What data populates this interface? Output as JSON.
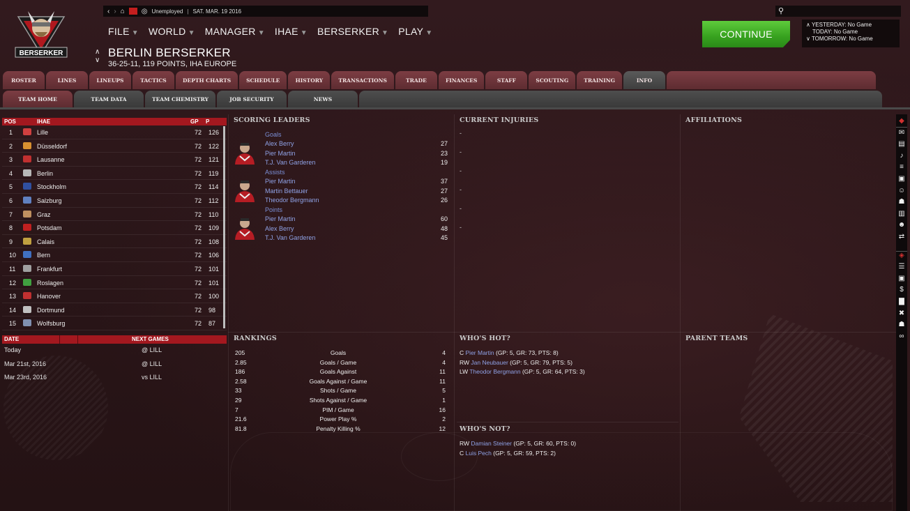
{
  "topbar": {
    "status": "Unemployed",
    "date": "SAT. MAR. 19 2016"
  },
  "logo_text": "BERSERKER",
  "menus": [
    {
      "label": "FILE"
    },
    {
      "label": "WORLD"
    },
    {
      "label": "MANAGER"
    },
    {
      "label": "IHAE"
    },
    {
      "label": "BERSERKER"
    },
    {
      "label": "PLAY"
    }
  ],
  "team": {
    "name": "BERLIN BERSERKER",
    "record": "36-25-11, 119 POINTS, IHA EUROPE"
  },
  "continue_label": "CONTINUE",
  "games": {
    "yesterday": "YESTERDAY: No Game",
    "today": "TODAY: No Game",
    "tomorrow": "TOMORROW: No Game"
  },
  "tabs_main": [
    "ROSTER",
    "LINES",
    "LINEUPS",
    "TACTICS",
    "DEPTH CHARTS",
    "SCHEDULE",
    "HISTORY",
    "TRANSACTIONS",
    "TRADE",
    "FINANCES",
    "STAFF",
    "SCOUTING",
    "TRAINING",
    "INFO"
  ],
  "tabs_main_active": "INFO",
  "tabs_sub": [
    "TEAM HOME",
    "TEAM DATA",
    "TEAM CHEMISTRY",
    "JOB SECURITY",
    "NEWS"
  ],
  "tabs_sub_active": "TEAM HOME",
  "standings": {
    "headers": {
      "pos": "POS",
      "league": "IHAE",
      "gp": "GP",
      "p": "P"
    },
    "rows": [
      {
        "pos": "1",
        "team": "Lille",
        "gp": "72",
        "p": "126",
        "color": "#d04040"
      },
      {
        "pos": "2",
        "team": "Düsseldorf",
        "gp": "72",
        "p": "122",
        "color": "#d89030"
      },
      {
        "pos": "3",
        "team": "Lausanne",
        "gp": "72",
        "p": "121",
        "color": "#c03030"
      },
      {
        "pos": "4",
        "team": "Berlin",
        "gp": "72",
        "p": "119",
        "color": "#b8b8b8"
      },
      {
        "pos": "5",
        "team": "Stockholm",
        "gp": "72",
        "p": "114",
        "color": "#3050a0"
      },
      {
        "pos": "6",
        "team": "Salzburg",
        "gp": "72",
        "p": "112",
        "color": "#6080c0"
      },
      {
        "pos": "7",
        "team": "Graz",
        "gp": "72",
        "p": "110",
        "color": "#c09060"
      },
      {
        "pos": "8",
        "team": "Potsdam",
        "gp": "72",
        "p": "109",
        "color": "#c02020"
      },
      {
        "pos": "9",
        "team": "Calais",
        "gp": "72",
        "p": "108",
        "color": "#c0a040"
      },
      {
        "pos": "10",
        "team": "Bern",
        "gp": "72",
        "p": "106",
        "color": "#4070c0"
      },
      {
        "pos": "11",
        "team": "Frankfurt",
        "gp": "72",
        "p": "101",
        "color": "#a0a0a0"
      },
      {
        "pos": "12",
        "team": "Roslagen",
        "gp": "72",
        "p": "101",
        "color": "#40a040"
      },
      {
        "pos": "13",
        "team": "Hanover",
        "gp": "72",
        "p": "100",
        "color": "#c03030"
      },
      {
        "pos": "14",
        "team": "Dortmund",
        "gp": "72",
        "p": "98",
        "color": "#c0c0c0"
      },
      {
        "pos": "15",
        "team": "Wolfsburg",
        "gp": "72",
        "p": "87",
        "color": "#8090b0"
      }
    ]
  },
  "schedule": {
    "headers": {
      "date": "DATE",
      "next": "NEXT GAMES"
    },
    "rows": [
      {
        "date": "Today",
        "game": "@ LILL"
      },
      {
        "date": "Mar 21st, 2016",
        "game": "@ LILL"
      },
      {
        "date": "Mar 23rd, 2016",
        "game": "vs LILL"
      }
    ]
  },
  "panels": {
    "scoring_leaders": "SCORING LEADERS",
    "current_injuries": "CURRENT INJURIES",
    "affiliations": "AFFILIATIONS",
    "rankings": "RANKINGS",
    "whos_hot": "WHO'S HOT?",
    "whos_not": "WHO'S NOT?",
    "parent_teams": "PARENT TEAMS"
  },
  "leaders": [
    {
      "category": "Goals",
      "players": [
        {
          "name": "Alex Berry",
          "value": "27"
        },
        {
          "name": "Pier Martin",
          "value": "23"
        },
        {
          "name": "T.J. Van Garderen",
          "value": "19"
        }
      ]
    },
    {
      "category": "Assists",
      "players": [
        {
          "name": "Pier Martin",
          "value": "37"
        },
        {
          "name": "Martin Bettauer",
          "value": "27"
        },
        {
          "name": "Theodor Bergmann",
          "value": "26"
        }
      ]
    },
    {
      "category": "Points",
      "players": [
        {
          "name": "Pier Martin",
          "value": "60"
        },
        {
          "name": "Alex Berry",
          "value": "48"
        },
        {
          "name": "T.J. Van Garderen",
          "value": "45"
        }
      ]
    }
  ],
  "injuries": [
    "-",
    "-",
    "-",
    "-",
    "-",
    "-"
  ],
  "rankings": [
    {
      "value": "205",
      "label": "Goals",
      "rank": "4"
    },
    {
      "value": "2.85",
      "label": "Goals / Game",
      "rank": "4"
    },
    {
      "value": "186",
      "label": "Goals Against",
      "rank": "11"
    },
    {
      "value": "2.58",
      "label": "Goals Against / Game",
      "rank": "11"
    },
    {
      "value": "33",
      "label": "Shots / Game",
      "rank": "5"
    },
    {
      "value": "29",
      "label": "Shots Against / Game",
      "rank": "1"
    },
    {
      "value": "7",
      "label": "PIM / Game",
      "rank": "16"
    },
    {
      "value": "21.6",
      "label": "Power Play %",
      "rank": "2"
    },
    {
      "value": "81.8",
      "label": "Penalty Killing %",
      "rank": "12"
    }
  ],
  "hot": [
    {
      "pos": "C",
      "name": "Pier Martin",
      "stats": "(GP: 5, GR: 73, PTS: 8)"
    },
    {
      "pos": "RW",
      "name": "Jan Neubauer",
      "stats": "(GP: 5, GR: 79, PTS: 5)"
    },
    {
      "pos": "LW",
      "name": "Theodor Bergmann",
      "stats": "(GP: 5, GR: 64, PTS: 3)"
    }
  ],
  "not": [
    {
      "pos": "RW",
      "name": "Damian Steiner",
      "stats": "(GP: 5, GR: 60, PTS: 0)"
    },
    {
      "pos": "C",
      "name": "Luis Pech",
      "stats": "(GP: 5, GR: 59, PTS: 2)"
    }
  ],
  "sidebar_icons": [
    "team-logo-icon",
    "inbox-icon",
    "clipboard-icon",
    "whistle-icon",
    "lines-icon",
    "jersey-icon",
    "people-icon",
    "trophy-icon",
    "notes-icon",
    "staff-icon",
    "transfer-icon",
    "league-logo-icon",
    "list-icon",
    "jersey-icon",
    "dollar-icon",
    "stats-icon",
    "sticks-icon",
    "trophy-icon",
    "binoculars-icon"
  ]
}
